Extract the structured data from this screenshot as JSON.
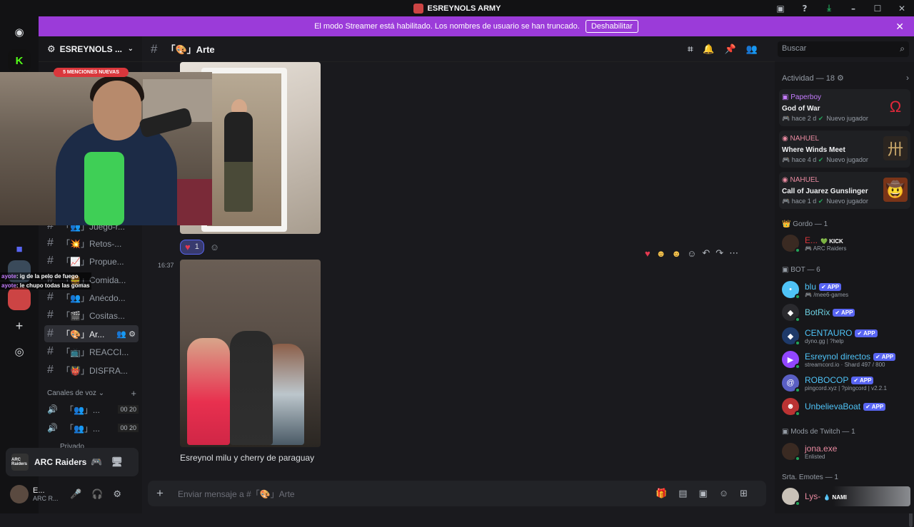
{
  "window": {
    "title": "ESREYNOLS ARMY"
  },
  "banner": {
    "text": "El modo Streamer está habilitado. Los nombres de usuario se han truncado.",
    "button": "Deshabilitar"
  },
  "server": {
    "name": "ESREYNOLS ...",
    "mentions_badge": "5 MENCIONES NUEVAS"
  },
  "channels": [
    {
      "name": "「👥」Juego-r...",
      "active": false
    },
    {
      "name": "「💥」Retos-...",
      "active": false
    },
    {
      "name": "「📈」Propue...",
      "active": false
    },
    {
      "name": "「🍔」Comida...",
      "active": false
    },
    {
      "name": "「👥」Anécdo...",
      "active": false
    },
    {
      "name": "「🎬」Cositas...",
      "active": false
    },
    {
      "name": "「🎨」Ar...",
      "active": true
    },
    {
      "name": "「📺」REACCI...",
      "active": false
    },
    {
      "name": "「👹」DISFRA...",
      "active": false
    }
  ],
  "voice": {
    "header": "Canales de voz",
    "channels": [
      {
        "name": "「👥」...",
        "count_a": "00",
        "count_b": "20"
      },
      {
        "name": "「👥」...",
        "count_a": "00",
        "count_b": "20"
      }
    ],
    "private": "Privado"
  },
  "activity_panel": {
    "game": "ARC Raiders",
    "game_icon_text": "ARC Raiders"
  },
  "user": {
    "name": "E...",
    "status": "ARC R..."
  },
  "channel_header": {
    "name": "「🎨」Arte"
  },
  "search": {
    "placeholder": "Buscar"
  },
  "messages": {
    "reaction_count": "1",
    "timestamp": "16:37",
    "caption": "Esreynol milu y cherry de paraguay"
  },
  "composer": {
    "placeholder": "Enviar mensaje a #「🎨」Arte"
  },
  "activity": {
    "header": "Actividad — 18",
    "items": [
      {
        "user": "Paperboy",
        "user_color": "#c57cff",
        "game": "God of War",
        "time": "hace 2 d",
        "tag": "Nuevo jugador",
        "art": "Ω",
        "art_color": "#e0283a"
      },
      {
        "user": "NAHUEL",
        "user_color": "#e98aa0",
        "game": "Where Winds Meet",
        "time": "hace 4 d",
        "tag": "Nuevo jugador",
        "art": "卅",
        "art_color": "#caa86a"
      },
      {
        "user": "NAHUEL",
        "user_color": "#e98aa0",
        "game": "Call of Juarez Gunslinger",
        "time": "hace 1 d",
        "tag": "Nuevo jugador",
        "art": "🤠",
        "art_color": "#c0582a"
      }
    ]
  },
  "members": {
    "group_gordo": "Gordo — 1",
    "gordo": {
      "name": "E...",
      "badge": "KICK",
      "sub": "ARC Raiders"
    },
    "group_bot": "BOT — 6",
    "bots": [
      {
        "name": "blu",
        "sub": "/mee6-games",
        "color": "#4fc3f7"
      },
      {
        "name": "BotRix",
        "sub": "",
        "color": "#6ed1e3"
      },
      {
        "name": "CENTAURO",
        "sub": "dyno.gg | ?help",
        "color": "#4fc3f7"
      },
      {
        "name": "Esreynol directos",
        "sub": "streamcord.io · Shard 497 / 800",
        "color": "#4fc3f7"
      },
      {
        "name": "ROBOCOP",
        "sub": "pingcord.xyz | ?pingcord | v2.2.1",
        "color": "#4fc3f7"
      },
      {
        "name": "UnbelievaBoat",
        "sub": "",
        "color": "#4fc3f7"
      }
    ],
    "app_badge": "APP",
    "group_mods": "Mods de Twitch — 1",
    "mod": {
      "name": "jona.exe",
      "sub": "Enlisted"
    },
    "group_emotes": "Srta. Emotes — 1",
    "emote": {
      "name": "Lys-",
      "badge": "NAMI"
    }
  },
  "overlay_chat": [
    {
      "user": "ayote",
      "text": ": ig de la pelo de fuego"
    },
    {
      "user": "ayote",
      "text": ": le chupo todas las gomas"
    }
  ]
}
